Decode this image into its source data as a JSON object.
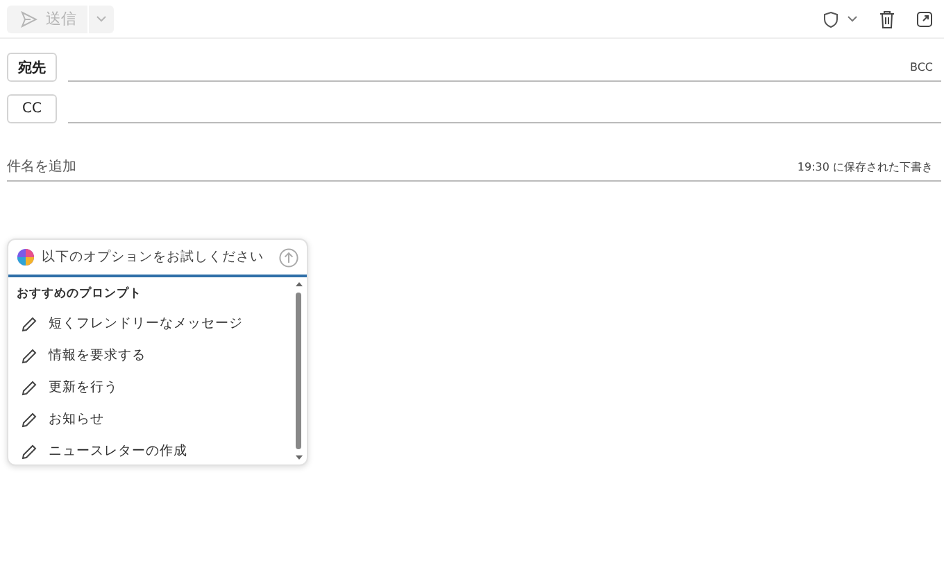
{
  "toolbar": {
    "send": {
      "label": "送信",
      "disabled": true
    }
  },
  "to": {
    "label": "宛先",
    "bcc": "BCC"
  },
  "cc": {
    "label": "CC"
  },
  "subject": {
    "placeholder": "件名を追加",
    "saved": "19:30 に保存された下書き"
  },
  "prompt": {
    "placeholder": "以下のオプションをお試しください",
    "section": "おすすめのプロンプト",
    "items": [
      "短くフレンドリーなメッセージ",
      "情報を要求する",
      "更新を行う",
      "お知らせ",
      "ニュースレターの作成"
    ]
  }
}
